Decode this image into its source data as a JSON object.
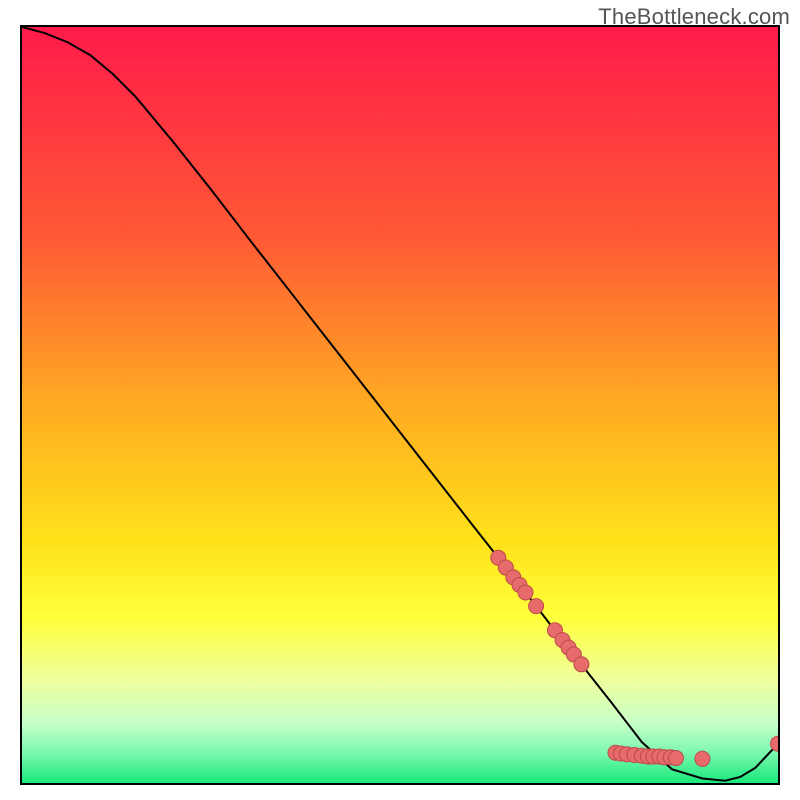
{
  "watermark": "TheBottleneck.com",
  "palette": {
    "bg_top": "#ff1b4a",
    "bg_mid1": "#ff7a2a",
    "bg_mid2": "#ffd31a",
    "bg_yellow": "#ffff3a",
    "bg_pale": "#f6ffbf",
    "bg_green": "#2cf58a",
    "curve": "#000000",
    "point_fill": "#e86b6b",
    "point_stroke": "#bc4a4a"
  },
  "chart_data": {
    "type": "line",
    "title": "",
    "xlabel": "",
    "ylabel": "",
    "xlim": [
      0,
      100
    ],
    "ylim": [
      0,
      100
    ],
    "grid": false,
    "legend": false,
    "series": [
      {
        "name": "bottleneck-curve",
        "x": [
          0,
          3,
          6,
          9,
          12,
          15,
          20,
          25,
          30,
          35,
          40,
          45,
          50,
          55,
          60,
          63,
          65,
          67,
          69,
          71,
          73,
          75,
          78,
          82,
          86,
          90,
          93,
          95,
          97,
          100
        ],
        "y": [
          100,
          99.2,
          98.0,
          96.3,
          93.8,
          90.8,
          84.8,
          78.5,
          72.0,
          65.6,
          59.2,
          52.8,
          46.4,
          40.0,
          33.6,
          29.8,
          27.2,
          24.7,
          22.1,
          19.5,
          17.0,
          14.4,
          10.6,
          5.4,
          1.8,
          0.6,
          0.3,
          0.8,
          2.0,
          5.2
        ]
      }
    ],
    "scatter_points": [
      {
        "x": 63.0,
        "y": 29.8
      },
      {
        "x": 64.0,
        "y": 28.5
      },
      {
        "x": 65.0,
        "y": 27.2
      },
      {
        "x": 65.8,
        "y": 26.2
      },
      {
        "x": 66.6,
        "y": 25.2
      },
      {
        "x": 68.0,
        "y": 23.4
      },
      {
        "x": 70.5,
        "y": 20.2
      },
      {
        "x": 71.5,
        "y": 18.9
      },
      {
        "x": 72.3,
        "y": 17.9
      },
      {
        "x": 73.0,
        "y": 17.0
      },
      {
        "x": 74.0,
        "y": 15.7
      },
      {
        "x": 78.5,
        "y": 4.0
      },
      {
        "x": 79.2,
        "y": 3.9
      },
      {
        "x": 80.0,
        "y": 3.8
      },
      {
        "x": 81.0,
        "y": 3.7
      },
      {
        "x": 82.0,
        "y": 3.6
      },
      {
        "x": 82.8,
        "y": 3.5
      },
      {
        "x": 83.5,
        "y": 3.5
      },
      {
        "x": 84.3,
        "y": 3.5
      },
      {
        "x": 85.0,
        "y": 3.4
      },
      {
        "x": 85.8,
        "y": 3.4
      },
      {
        "x": 86.5,
        "y": 3.3
      },
      {
        "x": 90.0,
        "y": 3.2
      },
      {
        "x": 100.0,
        "y": 5.2
      }
    ],
    "gradient_stops": [
      {
        "offset": 0.0,
        "color": "#ff1b4a"
      },
      {
        "offset": 0.28,
        "color": "#ff5a35"
      },
      {
        "offset": 0.5,
        "color": "#ffab22"
      },
      {
        "offset": 0.68,
        "color": "#ffe21a"
      },
      {
        "offset": 0.78,
        "color": "#ffff3a"
      },
      {
        "offset": 0.86,
        "color": "#f0ff9a"
      },
      {
        "offset": 0.92,
        "color": "#c8ffc8"
      },
      {
        "offset": 0.96,
        "color": "#7cf8b0"
      },
      {
        "offset": 1.0,
        "color": "#18e87a"
      }
    ]
  }
}
